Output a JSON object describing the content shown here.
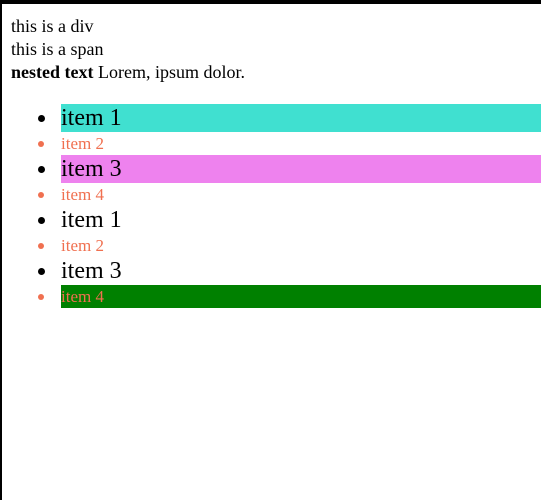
{
  "header": {
    "div_text": "this is a div",
    "span_text": "this is a span",
    "nested_bold": "nested text",
    "nested_rest": " Lorem, ipsum dolor."
  },
  "list": {
    "items": [
      {
        "label": "item 1",
        "bg": "#40e0d0",
        "color": "#000000",
        "bullet": "#000000"
      },
      {
        "label": "item 2",
        "bg": "",
        "color": "#f07050",
        "bullet": "#f07050"
      },
      {
        "label": "item 3",
        "bg": "#ee82ee",
        "color": "#000000",
        "bullet": "#000000"
      },
      {
        "label": "item 4",
        "bg": "",
        "color": "#f07050",
        "bullet": "#f07050"
      },
      {
        "label": "item 1",
        "bg": "",
        "color": "#000000",
        "bullet": "#000000"
      },
      {
        "label": "item 2",
        "bg": "",
        "color": "#f07050",
        "bullet": "#f07050"
      },
      {
        "label": "item 3",
        "bg": "",
        "color": "#000000",
        "bullet": "#000000"
      },
      {
        "label": "item 4",
        "bg": "#008000",
        "color": "#f07050",
        "bullet": "#f07050"
      }
    ]
  }
}
